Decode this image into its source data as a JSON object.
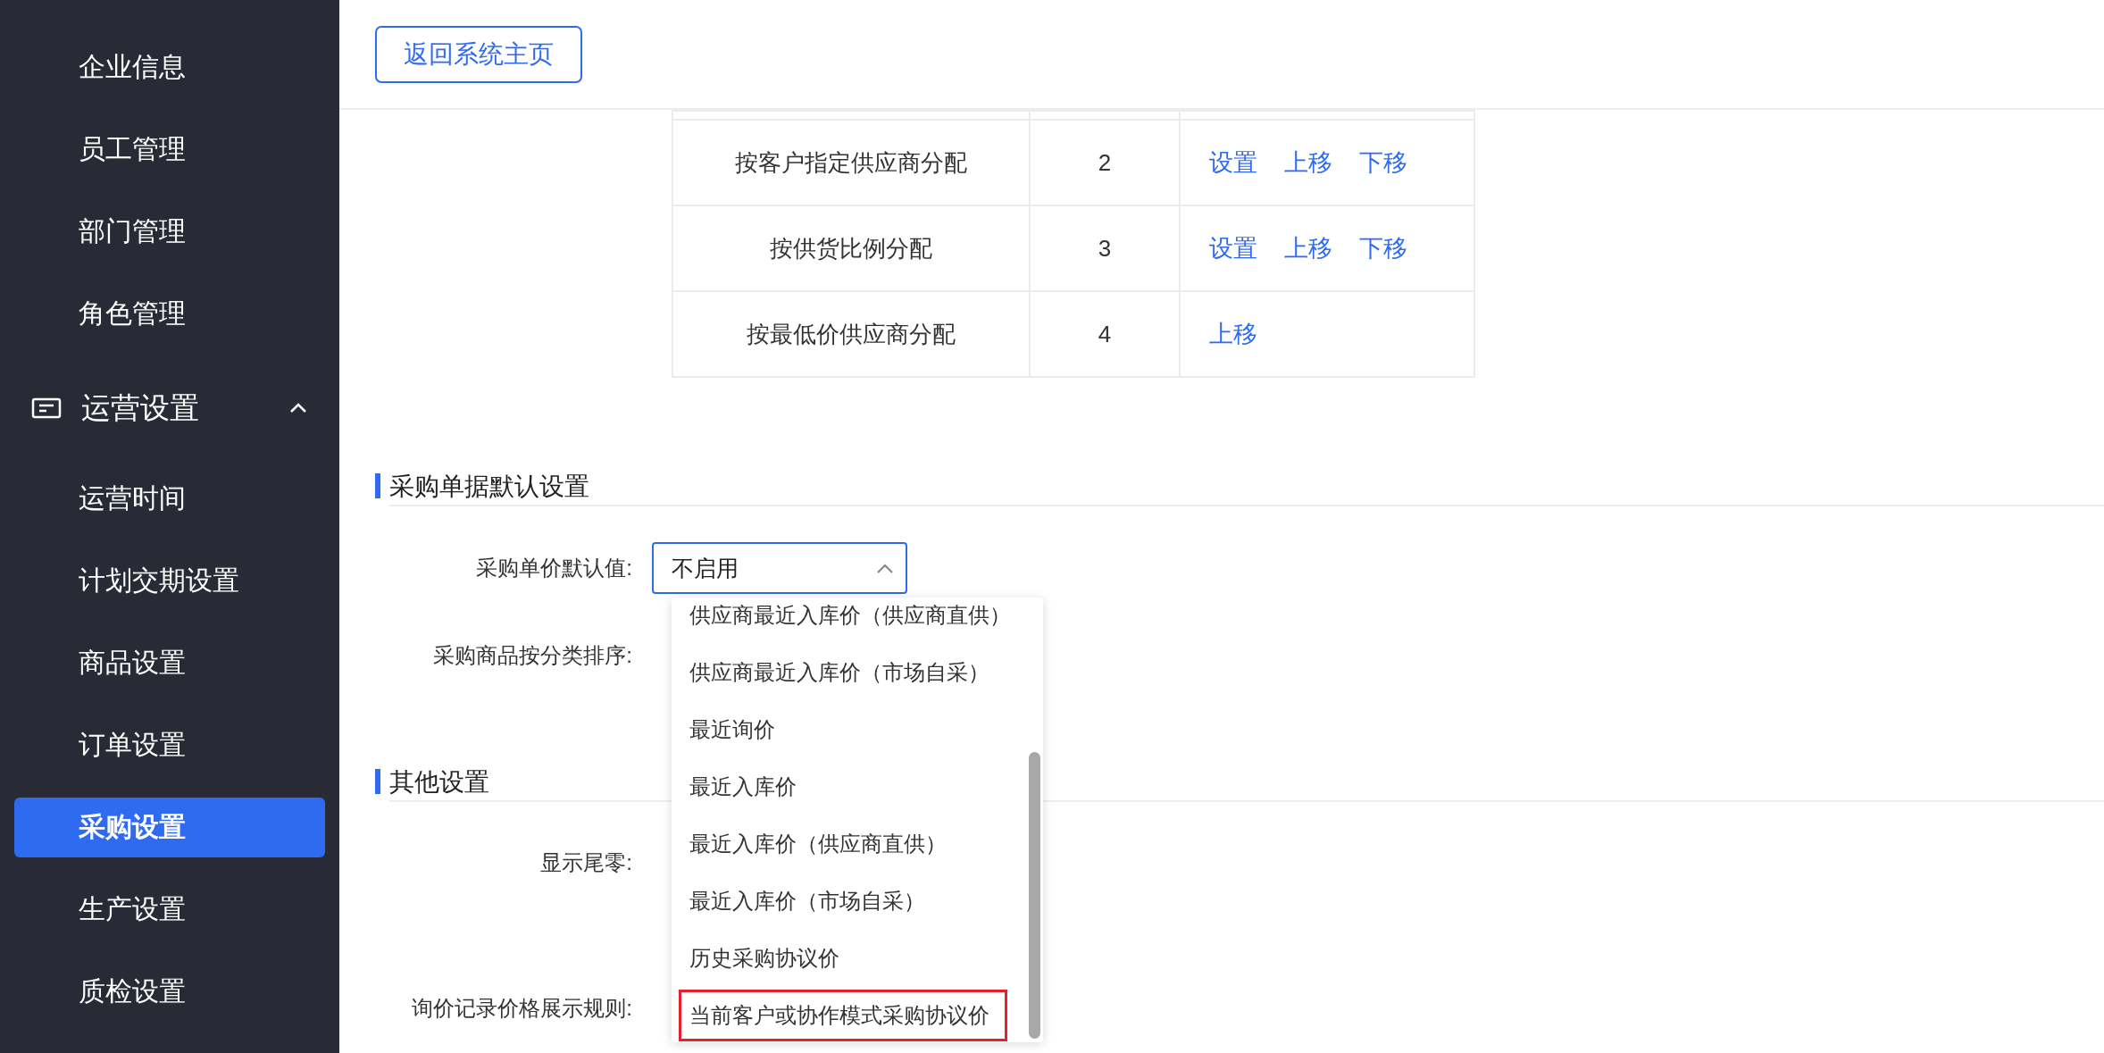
{
  "sidebar": {
    "items_top": [
      {
        "label": "企业信息",
        "selected": false
      },
      {
        "label": "员工管理",
        "selected": false
      },
      {
        "label": "部门管理",
        "selected": false
      },
      {
        "label": "角色管理",
        "selected": false
      }
    ],
    "group": {
      "label": "运营设置",
      "expanded": true,
      "items": [
        {
          "label": "运营时间",
          "selected": false
        },
        {
          "label": "计划交期设置",
          "selected": false
        },
        {
          "label": "商品设置",
          "selected": false
        },
        {
          "label": "订单设置",
          "selected": false
        },
        {
          "label": "采购设置",
          "selected": true
        },
        {
          "label": "生产设置",
          "selected": false
        },
        {
          "label": "质检设置",
          "selected": false
        }
      ]
    }
  },
  "header": {
    "back_button": "返回系统主页"
  },
  "table": {
    "rows": [
      {
        "name": "按客户指定供应商分配",
        "order": "2",
        "actions": [
          "设置",
          "上移",
          "下移"
        ]
      },
      {
        "name": "按供货比例分配",
        "order": "3",
        "actions": [
          "设置",
          "上移",
          "下移"
        ]
      },
      {
        "name": "按最低价供应商分配",
        "order": "4",
        "actions": [
          "上移"
        ]
      }
    ]
  },
  "sections": [
    {
      "title": "采购单据默认设置",
      "fields": [
        {
          "label": "采购单价默认值:",
          "kind": "select"
        },
        {
          "label": "采购商品按分类排序:",
          "kind": "plain"
        }
      ]
    },
    {
      "title": "其他设置",
      "fields": [
        {
          "label": "显示尾零:",
          "kind": "plain"
        },
        {
          "label": "询价记录价格展示规则:",
          "kind": "plain"
        }
      ]
    }
  ],
  "select": {
    "value": "不启用",
    "open": true,
    "options": [
      {
        "label": "供应商最近入库价（供应商直供）",
        "highlighted": false
      },
      {
        "label": "供应商最近入库价（市场自采）",
        "highlighted": false
      },
      {
        "label": "最近询价",
        "highlighted": false
      },
      {
        "label": "最近入库价",
        "highlighted": false
      },
      {
        "label": "最近入库价（供应商直供）",
        "highlighted": false
      },
      {
        "label": "最近入库价（市场自采）",
        "highlighted": false
      },
      {
        "label": "历史采购协议价",
        "highlighted": false
      },
      {
        "label": "当前客户或协作模式采购协议价",
        "highlighted": true
      }
    ]
  }
}
